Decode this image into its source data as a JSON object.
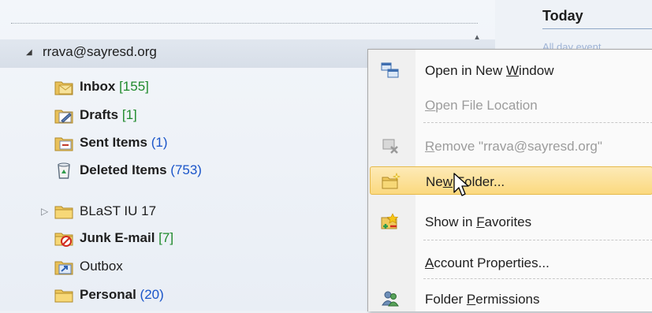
{
  "account": {
    "name": "rrava@sayresd.org"
  },
  "folders": [
    {
      "name": "Inbox",
      "count": "[155]",
      "icon": "inbox-icon"
    },
    {
      "name": "Drafts",
      "count": "[1]",
      "icon": "drafts-icon"
    },
    {
      "name": "Sent Items",
      "count": "(1)",
      "icon": "sent-items-icon"
    },
    {
      "name": "Deleted Items",
      "count": "(753)",
      "icon": "deleted-items-icon"
    },
    {
      "name": "BLaST IU 17",
      "count": "",
      "icon": "folder-icon"
    },
    {
      "name": "Junk E-mail",
      "count": "[7]",
      "icon": "junk-icon"
    },
    {
      "name": "Outbox",
      "count": "",
      "icon": "outbox-icon"
    },
    {
      "name": "Personal",
      "count": "(20)",
      "icon": "folder-icon"
    }
  ],
  "calendar": {
    "title": "Today",
    "all_day": "All day event"
  },
  "context_menu": {
    "items": [
      {
        "pre": "Open in New ",
        "key": "W",
        "post": "indow",
        "icon": "new-window-icon",
        "enabled": true
      },
      {
        "pre": "",
        "key": "O",
        "post": "pen File Location",
        "icon": "",
        "enabled": false
      },
      {
        "pre": "",
        "key": "R",
        "post": "emove \"rrava@sayresd.org\"",
        "icon": "remove-account-icon",
        "enabled": false
      },
      {
        "pre": "Ne",
        "key": "w",
        "post": " Folder...",
        "icon": "new-folder-icon",
        "enabled": true,
        "highlighted": true
      },
      {
        "pre": "Show in ",
        "key": "F",
        "post": "avorites",
        "icon": "favorites-icon",
        "enabled": true
      },
      {
        "pre": "",
        "key": "A",
        "post": "ccount Properties...",
        "icon": "",
        "enabled": true
      },
      {
        "pre": "Folder ",
        "key": "P",
        "post": "ermissions",
        "icon": "permissions-icon",
        "enabled": true
      }
    ]
  },
  "colors": {
    "highlight": "#fbd97f",
    "count_green": "#1f8a2c",
    "count_blue": "#1a55c9"
  }
}
